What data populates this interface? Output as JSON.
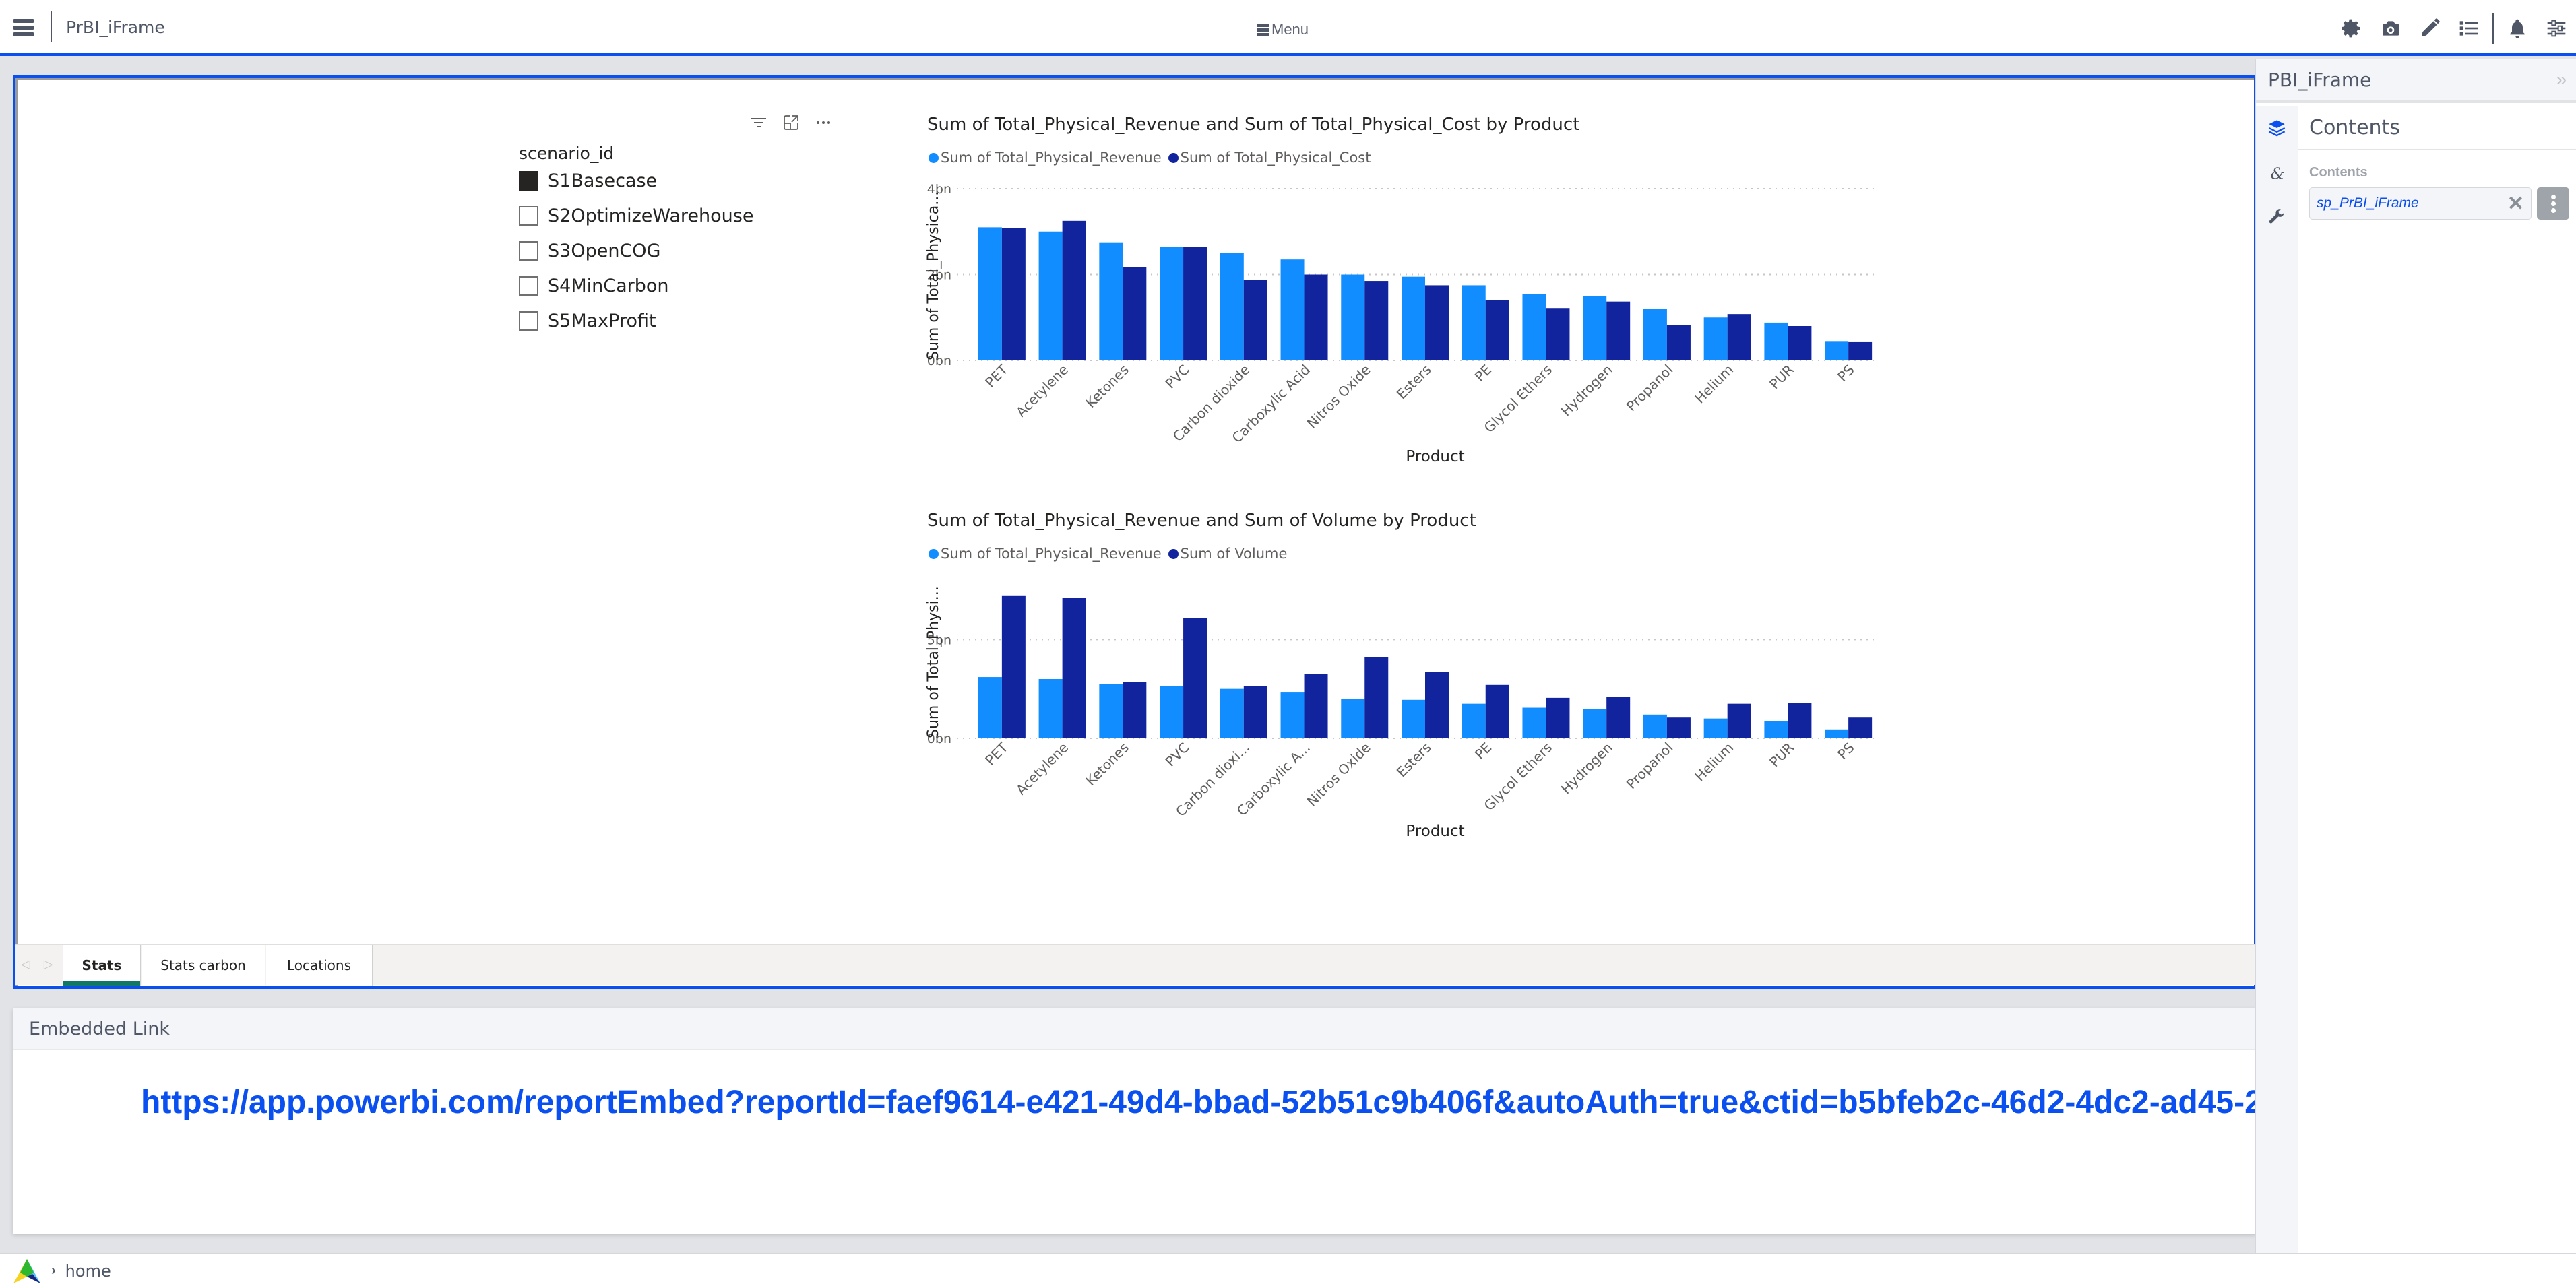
{
  "app": {
    "title": "PrBI_iFrame",
    "menu_label": "Menu"
  },
  "toolbar_icons": [
    "gear-icon",
    "camera-icon",
    "pencil-icon",
    "list-icon",
    "bell-icon",
    "sliders-icon"
  ],
  "slicer": {
    "title": "scenario_id",
    "items": [
      {
        "label": "S1Basecase",
        "checked": true
      },
      {
        "label": "S2OptimizeWarehouse",
        "checked": false
      },
      {
        "label": "S3OpenCOG",
        "checked": false
      },
      {
        "label": "S4MinCarbon",
        "checked": false
      },
      {
        "label": "S5MaxProfit",
        "checked": false
      }
    ]
  },
  "colors": {
    "series1": "#118dff",
    "series2": "#12239e",
    "accent": "#0a4ff0",
    "tab_active": "#117865"
  },
  "chart_data": [
    {
      "type": "bar",
      "title": "Sum of Total_Physical_Revenue and Sum of Total_Physical_Cost by Product",
      "xlabel": "Product",
      "ylabel": "Sum of Total_Physica...",
      "ylim": [
        0,
        4
      ],
      "yticks": [
        0,
        2,
        4
      ],
      "ytick_labels": [
        "0bn",
        "2bn",
        "4bn"
      ],
      "grid": true,
      "legend_position": "top-left",
      "categories": [
        "PET",
        "Acetylene",
        "Ketones",
        "PVC",
        "Carbon dioxide",
        "Carboxylic Acid",
        "Nitros Oxide",
        "Esters",
        "PE",
        "Glycol Ethers",
        "Hydrogen",
        "Propanol",
        "Helium",
        "PUR",
        "PS"
      ],
      "series": [
        {
          "name": "Sum of Total_Physical_Revenue",
          "values": [
            3.1,
            3.0,
            2.75,
            2.65,
            2.5,
            2.35,
            2.0,
            1.95,
            1.75,
            1.55,
            1.5,
            1.2,
            1.0,
            0.88,
            0.45
          ]
        },
        {
          "name": "Sum of Total_Physical_Cost",
          "values": [
            3.08,
            3.25,
            2.17,
            2.65,
            1.88,
            2.0,
            1.85,
            1.75,
            1.4,
            1.22,
            1.37,
            0.83,
            1.08,
            0.8,
            0.44
          ]
        }
      ]
    },
    {
      "type": "bar",
      "title": "Sum of Total_Physical_Revenue and Sum of Volume by Product",
      "xlabel": "Product",
      "ylabel": "Sum of Total_Physi...",
      "ylim": [
        0,
        7.5
      ],
      "yticks": [
        0,
        5
      ],
      "ytick_labels": [
        "0bn",
        "5bn"
      ],
      "grid": true,
      "legend_position": "top-left",
      "categories": [
        "PET",
        "Acetylene",
        "Ketones",
        "PVC",
        "Carbon dioxi...",
        "Carboxylic A...",
        "Nitros Oxide",
        "Esters",
        "PE",
        "Glycol Ethers",
        "Hydrogen",
        "Propanol",
        "Helium",
        "PUR",
        "PS"
      ],
      "series": [
        {
          "name": "Sum of Total_Physical_Revenue",
          "values": [
            3.1,
            3.0,
            2.75,
            2.65,
            2.5,
            2.35,
            2.0,
            1.95,
            1.75,
            1.55,
            1.5,
            1.2,
            1.0,
            0.88,
            0.45
          ]
        },
        {
          "name": "Sum of Volume",
          "values": [
            7.2,
            7.1,
            2.85,
            6.1,
            2.65,
            3.25,
            4.1,
            3.35,
            2.7,
            2.05,
            2.1,
            1.05,
            1.75,
            1.8,
            1.05
          ]
        }
      ]
    }
  ],
  "tabs": [
    {
      "label": "Stats",
      "active": true
    },
    {
      "label": "Stats carbon",
      "active": false
    },
    {
      "label": "Locations",
      "active": false
    }
  ],
  "embed": {
    "title": "Embedded Link",
    "url": "https://app.powerbi.com/reportEmbed?reportId=faef9614-e421-49d4-bbad-52b51c9b406f&autoAuth=true&ctid=b5bfeb2c-46d2-4dc2-ad45-2"
  },
  "right_panel": {
    "title": "PBI_iFrame",
    "section_title": "Contents",
    "field_label": "Contents",
    "field_value": "sp_PrBI_iFrame"
  },
  "footer": {
    "breadcrumb": "home"
  }
}
